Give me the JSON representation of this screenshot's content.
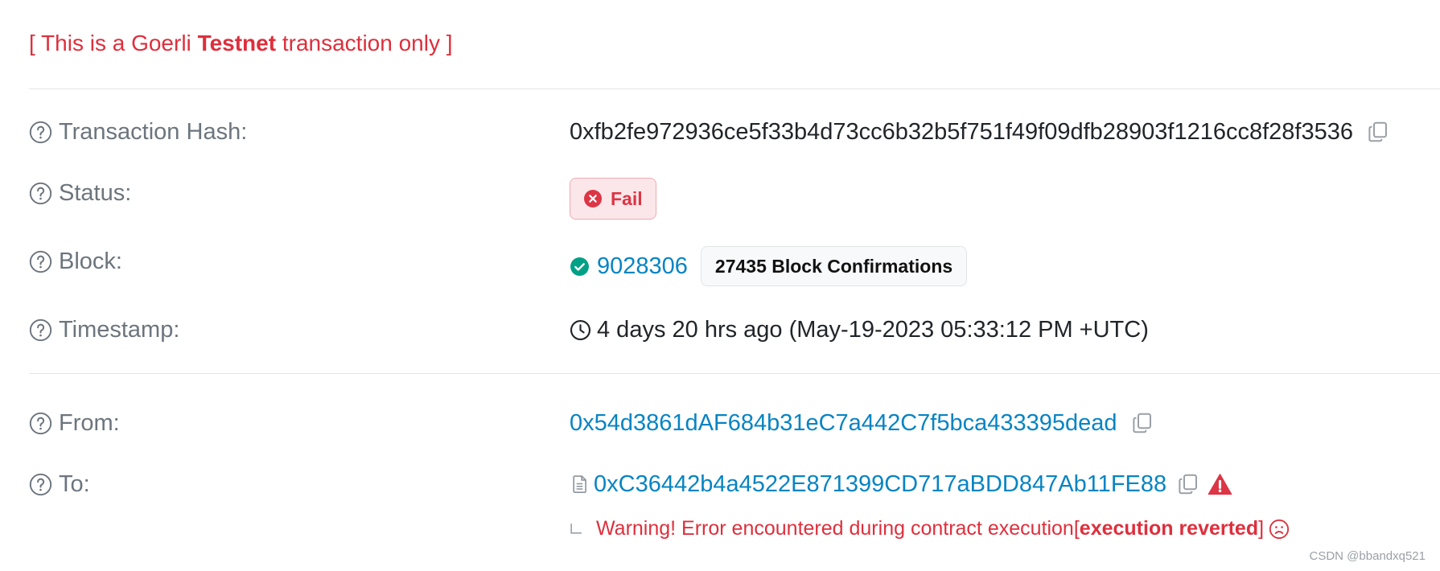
{
  "banner": {
    "prefix": "[ This is a Goerli ",
    "bold": "Testnet",
    "suffix": " transaction only ]"
  },
  "rows": {
    "tx_hash": {
      "label": "Transaction Hash:",
      "value": "0xfb2fe972936ce5f33b4d73cc6b32b5f751f49f09dfb28903f1216cc8f28f3536"
    },
    "status": {
      "label": "Status:",
      "value": "Fail"
    },
    "block": {
      "label": "Block:",
      "value": "9028306",
      "confirmations": "27435 Block Confirmations"
    },
    "timestamp": {
      "label": "Timestamp:",
      "value": "4 days 20 hrs ago (May-19-2023 05:33:12 PM +UTC)"
    },
    "from": {
      "label": "From:",
      "value": "0x54d3861dAF684b31eC7a442C7f5bca433395dead"
    },
    "to": {
      "label": "To:",
      "value": "0xC36442b4a4522E871399CD717aBDD847Ab11FE88"
    }
  },
  "warning": {
    "text": "Warning! Error encountered during contract execution ",
    "bracket_open": "[",
    "reason": "execution reverted",
    "bracket_close": "]"
  },
  "watermark": "CSDN @bbandxq521",
  "colors": {
    "link": "#0784c3",
    "danger": "#dc3545",
    "success": "#00a186",
    "label": "#6c757d"
  },
  "icons": [
    "question-circle-icon",
    "copy-icon",
    "x-circle-icon",
    "check-circle-icon",
    "clock-icon",
    "contract-file-icon",
    "warning-triangle-icon",
    "frown-icon"
  ]
}
